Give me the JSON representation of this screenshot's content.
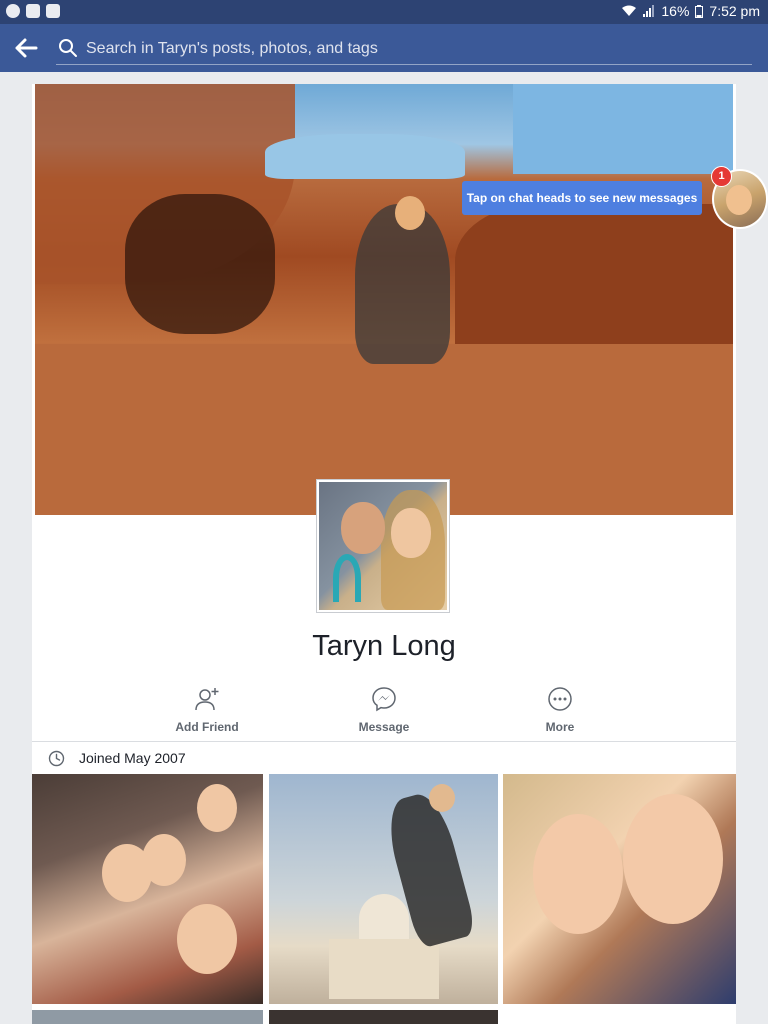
{
  "status_bar": {
    "battery": "16%",
    "time": "7:52 pm"
  },
  "search": {
    "placeholder": "Search in Taryn's posts, photos, and tags"
  },
  "chat": {
    "tooltip": "Tap on chat heads to see new messages",
    "badge_count": "1"
  },
  "profile": {
    "name": "Taryn Long",
    "joined": "Joined May 2007"
  },
  "actions": {
    "add_friend": "Add Friend",
    "message": "Message",
    "more": "More"
  },
  "colors": {
    "header": "#3b5998",
    "status_bar": "#2d4373",
    "tooltip": "#4e7fe0",
    "badge": "#e53935"
  }
}
